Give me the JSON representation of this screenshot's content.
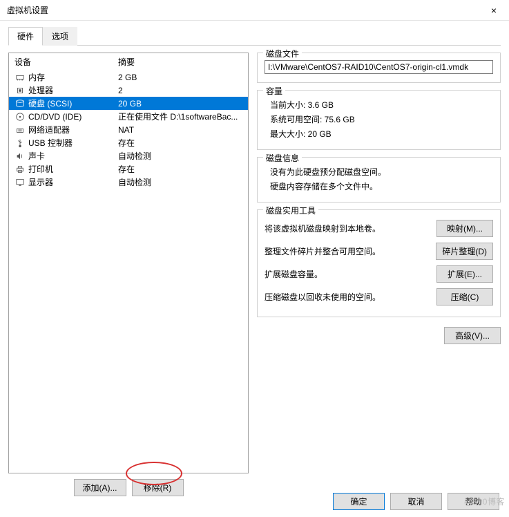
{
  "window": {
    "title": "虚拟机设置",
    "close": "×"
  },
  "tabs": {
    "hardware": "硬件",
    "options": "选项"
  },
  "list": {
    "header_device": "设备",
    "header_summary": "摘要",
    "rows": [
      {
        "icon": "memory",
        "device": "内存",
        "summary": "2 GB"
      },
      {
        "icon": "cpu",
        "device": "处理器",
        "summary": "2"
      },
      {
        "icon": "disk",
        "device": "硬盘 (SCSI)",
        "summary": "20 GB",
        "selected": true
      },
      {
        "icon": "cd",
        "device": "CD/DVD (IDE)",
        "summary": "正在使用文件 D:\\1softwareBac..."
      },
      {
        "icon": "net",
        "device": "网络适配器",
        "summary": "NAT"
      },
      {
        "icon": "usb",
        "device": "USB 控制器",
        "summary": "存在"
      },
      {
        "icon": "sound",
        "device": "声卡",
        "summary": "自动检测"
      },
      {
        "icon": "printer",
        "device": "打印机",
        "summary": "存在"
      },
      {
        "icon": "display",
        "device": "显示器",
        "summary": "自动检测"
      }
    ]
  },
  "left_buttons": {
    "add": "添加(A)...",
    "remove": "移除(R)"
  },
  "right": {
    "diskfile": {
      "legend": "磁盘文件",
      "value": "I:\\VMware\\CentOS7-RAID10\\CentOS7-origin-cl1.vmdk"
    },
    "capacity": {
      "legend": "容量",
      "current": "当前大小: 3.6 GB",
      "free": "系统可用空间: 75.6 GB",
      "max": "最大大小: 20 GB"
    },
    "diskinfo": {
      "legend": "磁盘信息",
      "line1": "没有为此硬盘预分配磁盘空间。",
      "line2": "硬盘内容存储在多个文件中。"
    },
    "utilities": {
      "legend": "磁盘实用工具",
      "map_label": "将该虚拟机磁盘映射到本地卷。",
      "map_btn": "映射(M)...",
      "defrag_label": "整理文件碎片并整合可用空间。",
      "defrag_btn": "碎片整理(D)",
      "expand_label": "扩展磁盘容量。",
      "expand_btn": "扩展(E)...",
      "compact_label": "压缩磁盘以回收未使用的空间。",
      "compact_btn": "压缩(C)"
    },
    "advanced_btn": "高级(V)..."
  },
  "bottom": {
    "ok": "确定",
    "cancel": "取消",
    "help": "帮助"
  },
  "watermark": "@510博客"
}
